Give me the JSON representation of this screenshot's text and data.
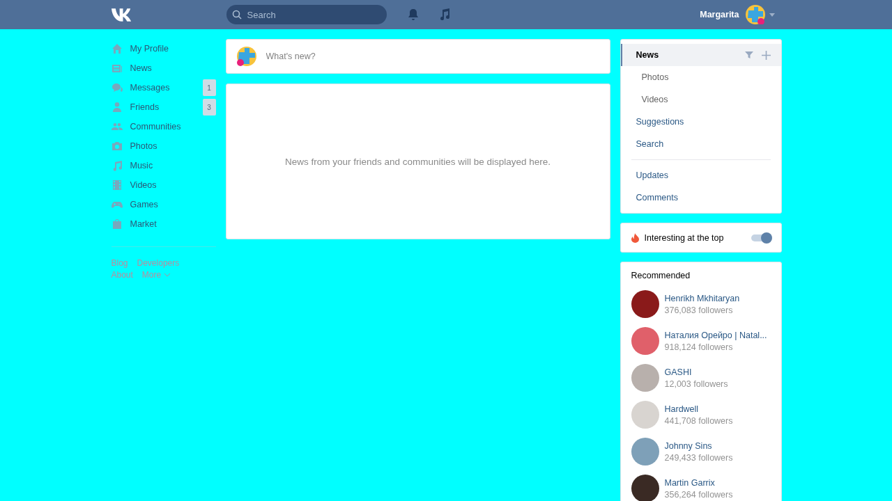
{
  "header": {
    "search": {
      "placeholder": "Search"
    },
    "user": {
      "name": "Margarita"
    }
  },
  "nav": [
    {
      "label": "My Profile"
    },
    {
      "label": "News"
    },
    {
      "label": "Messages",
      "badge": "1"
    },
    {
      "label": "Friends",
      "badge": "3"
    },
    {
      "label": "Communities"
    },
    {
      "label": "Photos"
    },
    {
      "label": "Music"
    },
    {
      "label": "Videos"
    },
    {
      "label": "Games"
    },
    {
      "label": "Market"
    }
  ],
  "footer_links": [
    {
      "label": "Blog"
    },
    {
      "label": "Developers"
    },
    {
      "label": "About"
    },
    {
      "label": "More",
      "kind": "dropdown"
    }
  ],
  "composer": {
    "placeholder": "What's new?"
  },
  "feed": {
    "empty_message": "News from your friends and communities will be displayed here."
  },
  "feed_menu": [
    [
      {
        "label": "News",
        "selected": true,
        "children": [
          {
            "label": "Photos",
            "selected": false
          },
          {
            "label": "Videos",
            "selected": false
          }
        ]
      },
      {
        "label": "Suggestions",
        "selected": false
      },
      {
        "label": "Search",
        "selected": false
      }
    ],
    [
      {
        "label": "Updates",
        "selected": false
      },
      {
        "label": "Comments",
        "selected": false
      }
    ]
  ],
  "interesting_toggle": {
    "label": "Interesting at the top",
    "on": true
  },
  "recommended": {
    "title": "Recommended",
    "items": [
      {
        "name": "Henrikh Mkhitaryan",
        "followers": "376,083 followers",
        "color": "#8a1a1a"
      },
      {
        "name": "Наталия Орейро | Natal...",
        "followers": "918,124 followers",
        "color": "#e0606a"
      },
      {
        "name": "GASHI",
        "followers": "12,003 followers",
        "color": "#b8b0ac"
      },
      {
        "name": "Hardwell",
        "followers": "441,708 followers",
        "color": "#d8d4d0"
      },
      {
        "name": "Johnny Sins",
        "followers": "249,433 followers",
        "color": "#7ea0b8"
      },
      {
        "name": "Martin Garrix",
        "followers": "356,264 followers",
        "color": "#3a2a24"
      }
    ]
  }
}
